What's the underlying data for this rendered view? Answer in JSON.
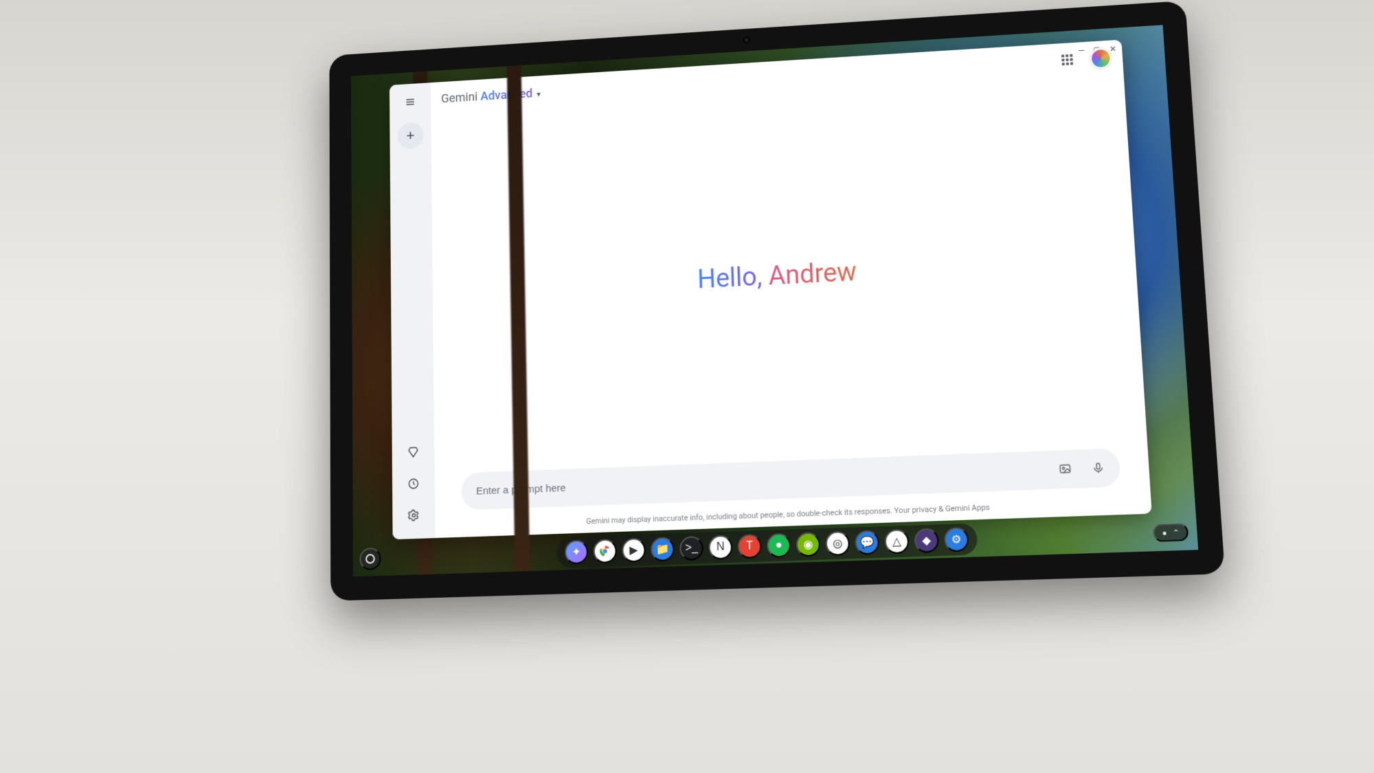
{
  "app": {
    "brand_primary": "Gemini",
    "brand_secondary": "Advanced"
  },
  "greeting": {
    "prefix": "Hello, ",
    "name": "Andrew"
  },
  "prompt": {
    "placeholder": "Enter a prompt here"
  },
  "disclaimer": "Gemini may display inaccurate info, including about people, so double-check its responses. Your privacy & Gemini Apps",
  "sidebar": {
    "menu_aria": "Main menu",
    "new_chat_aria": "New chat",
    "gem_aria": "Gem manager",
    "history_aria": "Activity",
    "settings_aria": "Settings"
  },
  "header_icons": {
    "apps_aria": "Google apps",
    "avatar_aria": "Account"
  },
  "prompt_icons": {
    "image_aria": "Add image",
    "mic_aria": "Use microphone"
  },
  "shelf": {
    "launcher_aria": "Launcher",
    "icons": [
      {
        "name": "gemini",
        "bg": "linear-gradient(135deg,#5aa0ff,#b06aff)",
        "glyph": "✦"
      },
      {
        "name": "chrome",
        "bg": "#fff",
        "glyph": ""
      },
      {
        "name": "play-store",
        "bg": "#fff",
        "glyph": "▶"
      },
      {
        "name": "files",
        "bg": "#2a7de0",
        "glyph": "📁"
      },
      {
        "name": "terminal",
        "bg": "#202124",
        "glyph": ">_"
      },
      {
        "name": "notion",
        "bg": "#fff",
        "glyph": "N"
      },
      {
        "name": "todoist",
        "bg": "#e44332",
        "glyph": "T"
      },
      {
        "name": "spotify",
        "bg": "#1db954",
        "glyph": "●"
      },
      {
        "name": "nvidia",
        "bg": "#76b900",
        "glyph": "◉"
      },
      {
        "name": "camera",
        "bg": "#fff",
        "glyph": "◎"
      },
      {
        "name": "messages",
        "bg": "#2a7de0",
        "glyph": "💬"
      },
      {
        "name": "drive",
        "bg": "#fff",
        "glyph": "△"
      },
      {
        "name": "obsidian",
        "bg": "#4a3a7a",
        "glyph": "◆"
      },
      {
        "name": "settings",
        "bg": "#2a7de0",
        "glyph": "⚙"
      }
    ],
    "tray_aria": "Status tray"
  },
  "window_controls": {
    "minimize_aria": "Minimize",
    "maximize_aria": "Maximize",
    "close_aria": "Close"
  }
}
